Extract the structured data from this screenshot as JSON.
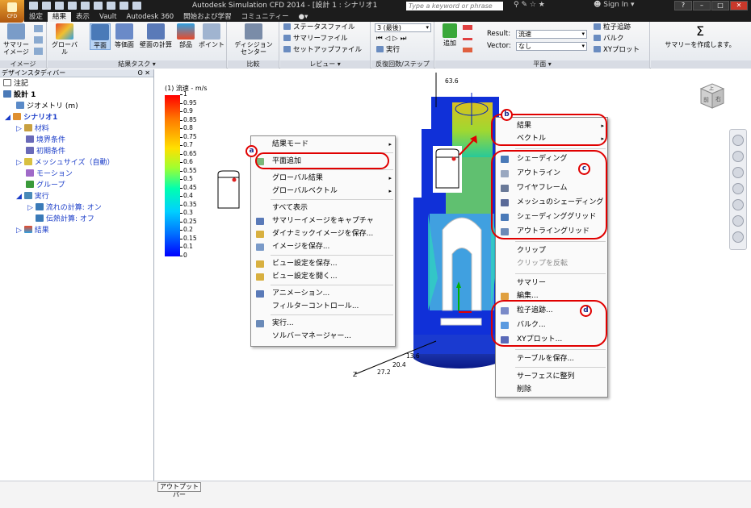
{
  "app": {
    "window_title": "Autodesk Simulation CFD 2014 - [設計 1 : シナリオ1",
    "logo_text": "CFD",
    "search_placeholder": "Type a keyword or phrase",
    "sign_in": "Sign In"
  },
  "tabs": [
    "設定",
    "結果",
    "表示",
    "Vault",
    "Autodesk 360",
    "開始および学習",
    "コミュニティー"
  ],
  "active_tab": "結果",
  "ribbon": {
    "image_group": {
      "label": "イメージ",
      "summary_image": "サマリー\nイメージ"
    },
    "result_tasks": {
      "label": "結果タスク ▾",
      "global": "グローバル",
      "plane": "平面",
      "isosurface": "等価面",
      "wall_calc": "壁面の計算",
      "parts": "部品",
      "points": "ポイント"
    },
    "compare": {
      "label": "比較",
      "decision_center": "ディシジョン\nセンター"
    },
    "review": {
      "label": "レビュー ▾",
      "status_file": "ステータスファイル",
      "summary_file": "サマリーファイル",
      "setup_file": "セットアップファイル"
    },
    "iterations": {
      "label": "反復回数/ステップ",
      "combo": "3 (最後)",
      "run": "実行"
    },
    "plane": {
      "label": "平面 ▾",
      "add": "追加",
      "result_label": "Result:",
      "result_value": "流速",
      "vector_label": "Vector:",
      "vector_value": "なし",
      "particle": "粒子追跡",
      "bulk": "バルク",
      "xy_plot": "XYプロット"
    },
    "summary": {
      "create": "サマリーを作成します。"
    }
  },
  "design_study": {
    "header": "デザインスタディバー",
    "pin": "ʘ ✕",
    "items": [
      {
        "label": "注記"
      },
      {
        "label": "設計 1"
      },
      {
        "label": "ジオメトリ (m)"
      },
      {
        "label": "シナリオ1"
      },
      {
        "label": "材料"
      },
      {
        "label": "境界条件"
      },
      {
        "label": "初期条件"
      },
      {
        "label": "メッシュサイズ（自動）"
      },
      {
        "label": "モーション"
      },
      {
        "label": "グループ"
      },
      {
        "label": "実行"
      },
      {
        "label": "流れの計算: オン"
      },
      {
        "label": "伝熱計算: オフ"
      },
      {
        "label": "結果"
      }
    ]
  },
  "legend": {
    "title": "(1) 流速 - m/s",
    "ticks": [
      "1",
      "0.95",
      "0.9",
      "0.85",
      "0.8",
      "0.75",
      "0.7",
      "0.65",
      "0.6",
      "0.55",
      "0.5",
      "0.45",
      "0.4",
      "0.35",
      "0.3",
      "0.25",
      "0.2",
      "0.15",
      "0.1",
      "0"
    ]
  },
  "axis_labels": {
    "top": "63.6",
    "v1": "13.6",
    "v2": "20.4",
    "v3": "27.2",
    "z": "Z"
  },
  "menu_left": {
    "items": [
      {
        "label": "結果モード",
        "arrow": "▸",
        "state": "normal",
        "icon": "none"
      },
      {
        "label": "平面追加",
        "arrow": "",
        "state": "normal",
        "icon": "plane-add-icon"
      },
      {
        "label": "グローバル結果",
        "arrow": "▸",
        "state": "normal",
        "icon": "none"
      },
      {
        "label": "グローバルベクトル",
        "arrow": "▸",
        "state": "normal",
        "icon": "none"
      },
      {
        "label": "すべて表示",
        "arrow": "",
        "state": "normal",
        "icon": "none"
      },
      {
        "label": "サマリーイメージをキャプチャ",
        "arrow": "",
        "state": "normal",
        "icon": "camera-icon"
      },
      {
        "label": "ダイナミックイメージを保存...",
        "arrow": "",
        "state": "normal",
        "icon": "dynamic-image-icon"
      },
      {
        "label": "イメージを保存...",
        "arrow": "",
        "state": "normal",
        "icon": "save-image-icon"
      },
      {
        "label": "ビュー設定を保存...",
        "arrow": "",
        "state": "normal",
        "icon": "save-view-icon"
      },
      {
        "label": "ビュー設定を開く...",
        "arrow": "",
        "state": "normal",
        "icon": "open-view-icon"
      },
      {
        "label": "アニメーション...",
        "arrow": "",
        "state": "normal",
        "icon": "animation-icon"
      },
      {
        "label": "フィルターコントロール...",
        "arrow": "",
        "state": "normal",
        "icon": "none"
      },
      {
        "label": "実行...",
        "arrow": "",
        "state": "normal",
        "icon": "run-icon"
      },
      {
        "label": "ソルバーマネージャー...",
        "arrow": "",
        "state": "normal",
        "icon": "none"
      }
    ]
  },
  "menu_right": {
    "items": [
      {
        "label": "結果",
        "arrow": "▸",
        "state": "normal",
        "icon": "none"
      },
      {
        "label": "ベクトル",
        "arrow": "▸",
        "state": "normal",
        "icon": "none"
      },
      {
        "label": "シェーディング",
        "arrow": "",
        "state": "normal",
        "icon": "shading-icon"
      },
      {
        "label": "アウトライン",
        "arrow": "",
        "state": "normal",
        "icon": "outline-icon"
      },
      {
        "label": "ワイヤフレーム",
        "arrow": "",
        "state": "normal",
        "icon": "wireframe-icon"
      },
      {
        "label": "メッシュのシェーディング",
        "arrow": "",
        "state": "normal",
        "icon": "mesh-shading-icon"
      },
      {
        "label": "シェーディンググリッド",
        "arrow": "",
        "state": "normal",
        "icon": "shading-grid-icon"
      },
      {
        "label": "アウトライングリッド",
        "arrow": "",
        "state": "normal",
        "icon": "outline-grid-icon"
      },
      {
        "label": "クリップ",
        "arrow": "",
        "state": "normal",
        "icon": "none"
      },
      {
        "label": "クリップを反転",
        "arrow": "",
        "state": "disabled",
        "icon": "none"
      },
      {
        "label": "サマリー",
        "arrow": "",
        "state": "normal",
        "icon": "none"
      },
      {
        "label": "編集...",
        "arrow": "",
        "state": "normal",
        "icon": "edit-icon"
      },
      {
        "label": "粒子追跡...",
        "arrow": "",
        "state": "normal",
        "icon": "particle-icon"
      },
      {
        "label": "バルク...",
        "arrow": "",
        "state": "normal",
        "icon": "bulk-icon"
      },
      {
        "label": "XYプロット...",
        "arrow": "",
        "state": "normal",
        "icon": "xy-plot-icon"
      },
      {
        "label": "テーブルを保存...",
        "arrow": "",
        "state": "normal",
        "icon": "none"
      },
      {
        "label": "サーフェスに整列",
        "arrow": "",
        "state": "normal",
        "icon": "none"
      },
      {
        "label": "削除",
        "arrow": "",
        "state": "normal",
        "icon": "none"
      }
    ]
  },
  "badges": {
    "a": "a",
    "b": "b",
    "c": "c",
    "d": "d"
  },
  "viewcube": {
    "top": "上",
    "front": "前",
    "right": "右"
  },
  "output_tab": "アウトプットバー",
  "colors": {
    "highlight": "#e00000",
    "accent_blue": "#1a3cc8",
    "ribbon_select": "#b8d4f4"
  }
}
